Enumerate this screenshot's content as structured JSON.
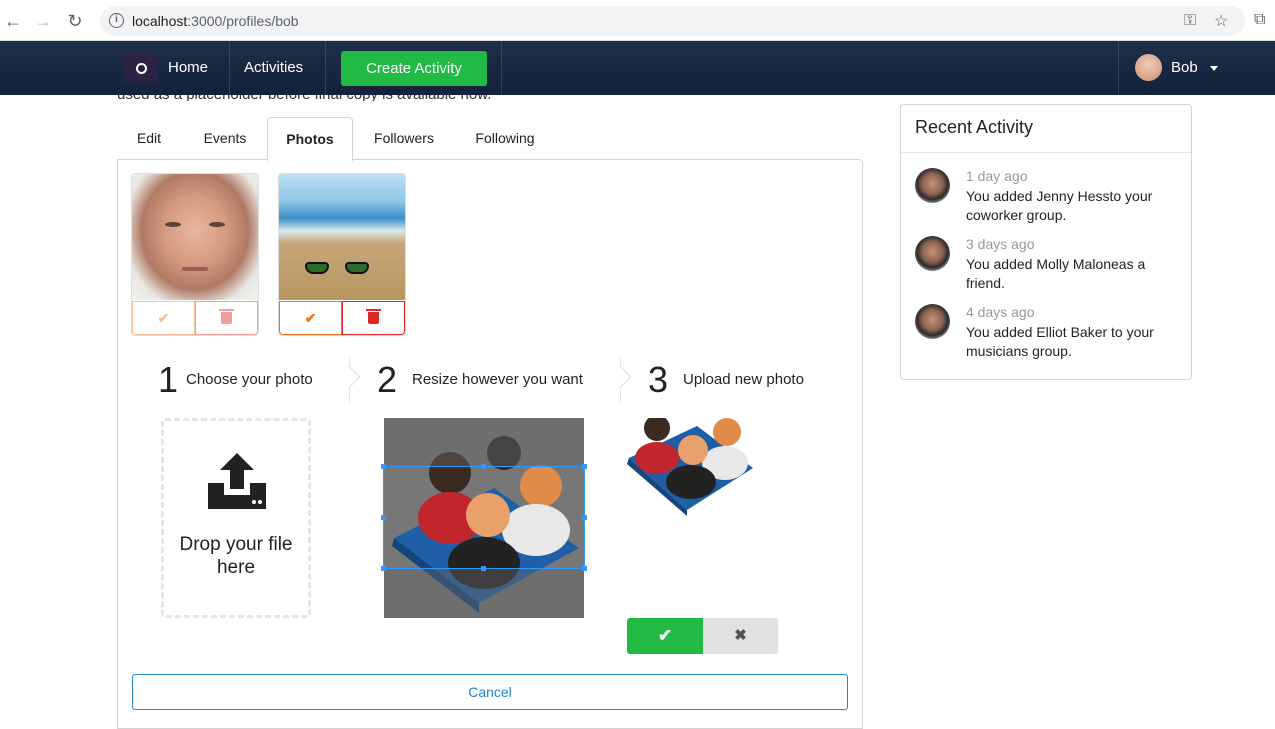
{
  "browser": {
    "url_host": "localhost",
    "url_path": ":3000/profiles/bob"
  },
  "navbar": {
    "home": "Home",
    "activities": "Activities",
    "create_activity": "Create Activity",
    "user_name": "Bob"
  },
  "page": {
    "cutoff_text": "used as a placeholder before final copy is available now."
  },
  "tabs": [
    {
      "label": "Edit"
    },
    {
      "label": "Events"
    },
    {
      "label": "Photos",
      "active": true
    },
    {
      "label": "Followers"
    },
    {
      "label": "Following"
    }
  ],
  "steps": [
    {
      "number": "1",
      "label": "Choose your photo"
    },
    {
      "number": "2",
      "label": "Resize however you want"
    },
    {
      "number": "3",
      "label": "Upload new photo"
    }
  ],
  "dropzone": {
    "text": "Drop your file here"
  },
  "buttons": {
    "confirm_icon": "✔",
    "cancel_icon": "✖",
    "cancel": "Cancel"
  },
  "recent_activity": {
    "title": "Recent Activity",
    "items": [
      {
        "date": "1 day ago",
        "text": "You added Jenny Hessto your coworker group."
      },
      {
        "date": "3 days ago",
        "text": "You added Molly Maloneas a friend."
      },
      {
        "date": "4 days ago",
        "text": "You added Elliot Baker to your musicians group."
      }
    ]
  },
  "colors": {
    "navbar": "#1f2f4a",
    "primary_green": "#21ba45",
    "orange": "#f2711c",
    "red": "#db2828",
    "blue": "#2185d0"
  }
}
